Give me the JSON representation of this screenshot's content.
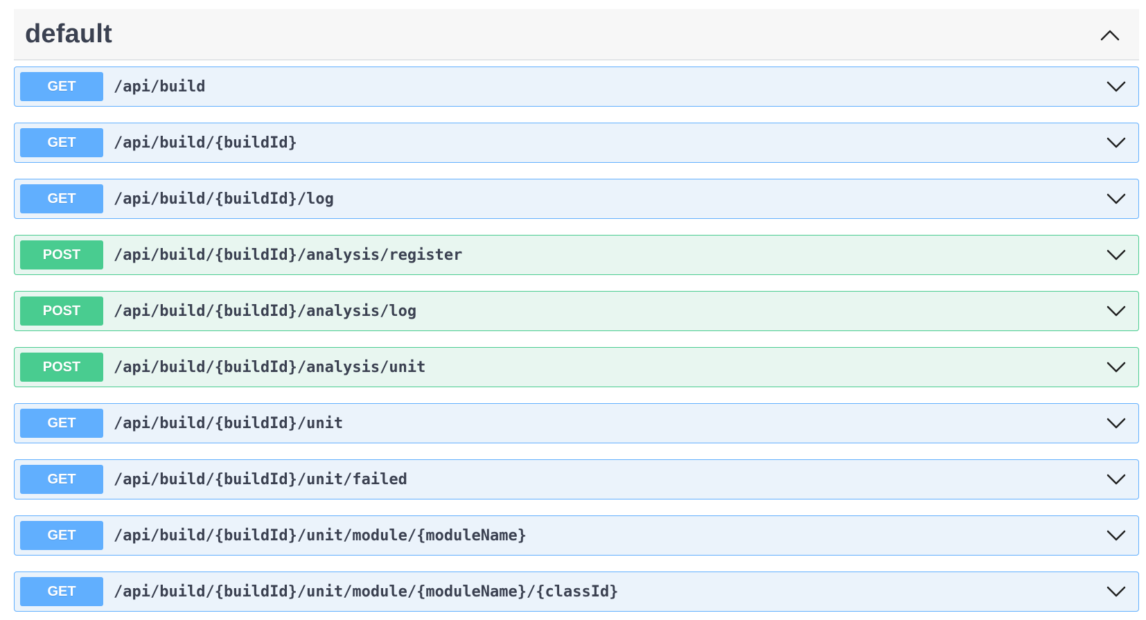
{
  "section": {
    "title": "default",
    "toggle_icon": "chevron-up-icon"
  },
  "colors": {
    "get_accent": "#61affe",
    "get_background": "#ebf3fb",
    "post_accent": "#49cc90",
    "post_background": "#e8f6f0",
    "text": "#3b4151"
  },
  "operations": [
    {
      "method": "GET",
      "path": "/api/build"
    },
    {
      "method": "GET",
      "path": "/api/build/{buildId}"
    },
    {
      "method": "GET",
      "path": "/api/build/{buildId}/log"
    },
    {
      "method": "POST",
      "path": "/api/build/{buildId}/analysis/register"
    },
    {
      "method": "POST",
      "path": "/api/build/{buildId}/analysis/log"
    },
    {
      "method": "POST",
      "path": "/api/build/{buildId}/analysis/unit"
    },
    {
      "method": "GET",
      "path": "/api/build/{buildId}/unit"
    },
    {
      "method": "GET",
      "path": "/api/build/{buildId}/unit/failed"
    },
    {
      "method": "GET",
      "path": "/api/build/{buildId}/unit/module/{moduleName}"
    },
    {
      "method": "GET",
      "path": "/api/build/{buildId}/unit/module/{moduleName}/{classId}"
    }
  ],
  "operation_expand_icon": "chevron-down-icon"
}
